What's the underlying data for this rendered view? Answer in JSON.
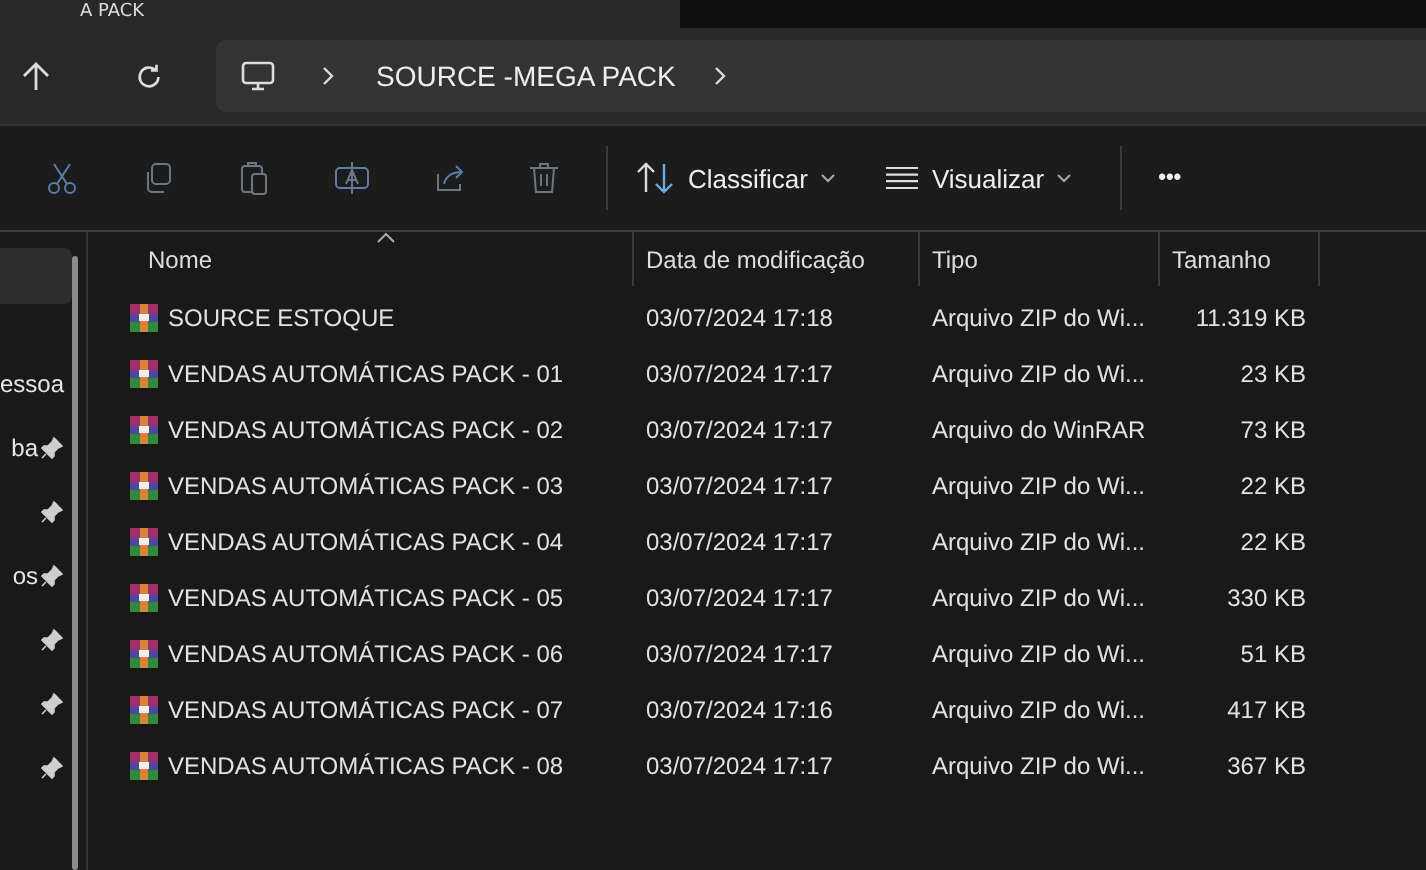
{
  "tab": {
    "title": "A PACK"
  },
  "address": {
    "crumbs": [
      "SOURCE -MEGA PACK"
    ]
  },
  "toolbar": {
    "sort": "Classificar",
    "view": "Visualizar",
    "more": "•••"
  },
  "sidebar": {
    "items": [
      {
        "pinned": false,
        "selected": true
      },
      {
        "label": "essoa",
        "pinned": false,
        "selected": false
      },
      {
        "label": "ba",
        "pinned": true,
        "selected": false
      },
      {
        "pinned": true,
        "selected": false
      },
      {
        "label": "os",
        "pinned": true,
        "selected": false
      },
      {
        "pinned": true,
        "selected": false
      },
      {
        "pinned": true,
        "selected": false
      },
      {
        "pinned": true,
        "selected": false
      }
    ]
  },
  "table": {
    "columns": [
      "Nome",
      "Data de modificação",
      "Tipo",
      "Tamanho"
    ],
    "rows": [
      {
        "name": "SOURCE ESTOQUE",
        "modified": "03/07/2024 17:18",
        "type": "Arquivo ZIP do Wi...",
        "size": "11.319 KB"
      },
      {
        "name": "VENDAS AUTOMÁTICAS PACK - 01",
        "modified": "03/07/2024 17:17",
        "type": "Arquivo ZIP do Wi...",
        "size": "23 KB"
      },
      {
        "name": "VENDAS AUTOMÁTICAS PACK - 02",
        "modified": "03/07/2024 17:17",
        "type": "Arquivo do WinRAR",
        "size": "73 KB"
      },
      {
        "name": "VENDAS AUTOMÁTICAS PACK - 03",
        "modified": "03/07/2024 17:17",
        "type": "Arquivo ZIP do Wi...",
        "size": "22 KB"
      },
      {
        "name": "VENDAS AUTOMÁTICAS PACK - 04",
        "modified": "03/07/2024 17:17",
        "type": "Arquivo ZIP do Wi...",
        "size": "22 KB"
      },
      {
        "name": "VENDAS AUTOMÁTICAS PACK - 05",
        "modified": "03/07/2024 17:17",
        "type": "Arquivo ZIP do Wi...",
        "size": "330 KB"
      },
      {
        "name": "VENDAS AUTOMÁTICAS PACK - 06",
        "modified": "03/07/2024 17:17",
        "type": "Arquivo ZIP do Wi...",
        "size": "51 KB"
      },
      {
        "name": "VENDAS AUTOMÁTICAS PACK - 07",
        "modified": "03/07/2024 17:16",
        "type": "Arquivo ZIP do Wi...",
        "size": "417 KB"
      },
      {
        "name": "VENDAS AUTOMÁTICAS PACK - 08",
        "modified": "03/07/2024 17:17",
        "type": "Arquivo ZIP do Wi...",
        "size": "367 KB"
      }
    ]
  }
}
